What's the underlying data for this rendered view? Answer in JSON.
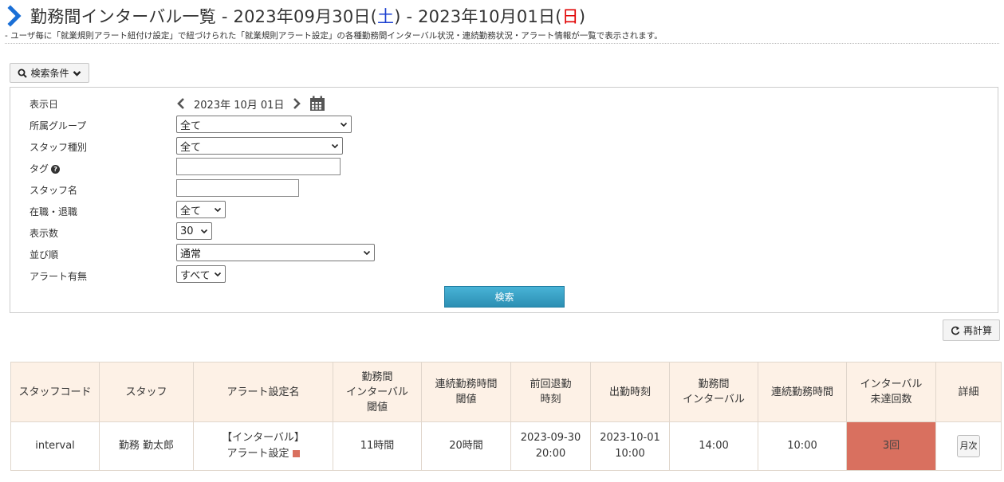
{
  "header": {
    "title_main": "勤務間インターバル一覧 - 2023年09月30日(",
    "title_sat": "土",
    "title_mid": ") - 2023年10月01日(",
    "title_sun": "日",
    "title_end": ")",
    "subtitle": "- ユーザ毎に「就業規則アラート紐付け設定」で紐づけられた「就業規則アラート設定」の各種勤務間インターバル状況・連続勤務状況・アラート情報が一覧で表示されます。"
  },
  "search": {
    "toggle_label": "検索条件",
    "fields": {
      "display_date_label": "表示日",
      "display_date_value": "2023年 10月 01日",
      "group_label": "所属グループ",
      "group_value": "全て",
      "staff_type_label": "スタッフ種別",
      "staff_type_value": "全て",
      "tag_label": "タグ",
      "tag_value": "",
      "staff_name_label": "スタッフ名",
      "staff_name_value": "",
      "employment_label": "在職・退職",
      "employment_value": "全て",
      "count_label": "表示数",
      "count_value": "30",
      "order_label": "並び順",
      "order_value": "通常",
      "alert_label": "アラート有無",
      "alert_value": "すべて"
    },
    "submit_label": "検索"
  },
  "recalc_label": "再計算",
  "table": {
    "headers": {
      "staff_code": "スタッフコード",
      "staff": "スタッフ",
      "alert_name": "アラート設定名",
      "interval_threshold_1": "勤務間",
      "interval_threshold_2": "インターバル",
      "interval_threshold_3": "閾値",
      "consec_threshold_1": "連続勤務時間",
      "consec_threshold_2": "閾値",
      "prev_leave_1": "前回退勤",
      "prev_leave_2": "時刻",
      "clock_in": "出勤時刻",
      "interval_1": "勤務間",
      "interval_2": "インターバル",
      "consec_time": "連続勤務時間",
      "unmet_1": "インターバル",
      "unmet_2": "未達回数",
      "detail": "詳細"
    },
    "rows": [
      {
        "staff_code": "interval",
        "staff": "勤務 勤太郎",
        "alert_name_1": "【インターバル】",
        "alert_name_2": "アラート設定",
        "interval_threshold": "11時間",
        "consec_threshold": "20時間",
        "prev_leave_date": "2023-09-30",
        "prev_leave_time": "20:00",
        "clock_in_date": "2023-10-01",
        "clock_in_time": "10:00",
        "interval": "14:00",
        "consec_time": "10:00",
        "unmet_count": "3回",
        "detail_button": "月次"
      }
    ]
  },
  "colors": {
    "accent_blue": "#1a6fd6",
    "saturday": "#1a3fd1",
    "sunday": "#e00000",
    "header_bg": "#fdf1e6",
    "alert_cell": "#d9705f",
    "search_button": "#2c8fb3"
  },
  "icons": {
    "title": "chevron-right-icon",
    "search": "search-icon",
    "toggle": "chevron-down-icon",
    "date_prev": "chevron-left-icon",
    "date_next": "chevron-right-icon",
    "calendar": "calendar-icon",
    "help": "question-circle-icon",
    "recalc": "refresh-icon"
  }
}
